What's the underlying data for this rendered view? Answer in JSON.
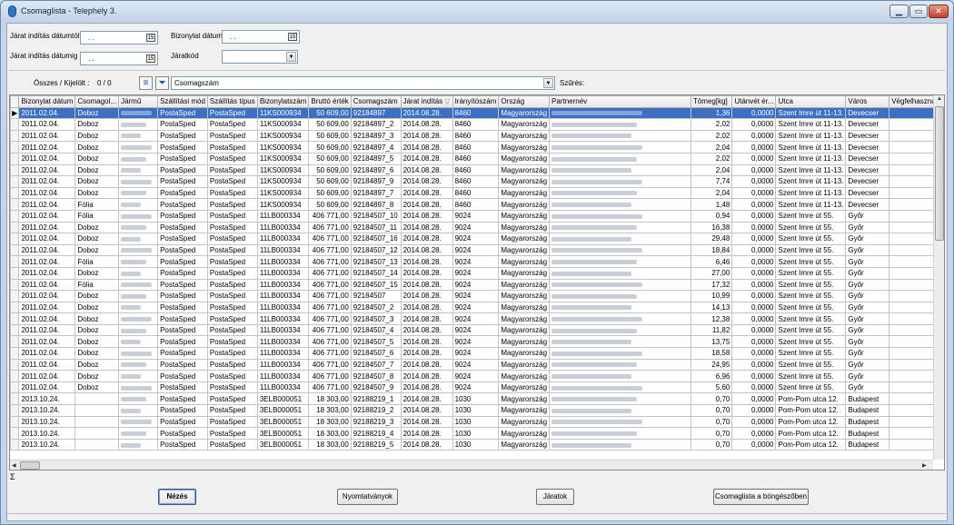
{
  "window": {
    "title": "Csomaglista  -  Telephely 3.",
    "min": "▁",
    "max": "▭",
    "close": "✕"
  },
  "filters": {
    "date_from_label": "Járat indítás dátumtól",
    "date_to_label": "Járat indítás dátumig",
    "doc_date_label": "Bizonylat dátum",
    "route_code_label": "Járatkód",
    "date_from_value": ". .",
    "date_to_value": ". .",
    "doc_date_value": ". .",
    "route_code_value": "",
    "calendar_icon": "calendar-icon"
  },
  "toolbar": {
    "counter_label": "Összes / Kijelölt :",
    "counter_value": "0 / 0",
    "column_selector_value": "Csomagszám",
    "filter_label": "Szűrés:"
  },
  "grid": {
    "columns": [
      "Bizonylat dátum",
      "Csomagol...",
      "Jármű",
      "Szállítási mód",
      "Szállítás típus",
      "Bizonylatszám",
      "Bruttó érték",
      "Csomagszám",
      "Járat indítás",
      "Irányítószám",
      "Ország",
      "Partnernév",
      "Tömeg[kg]",
      "Utánvét ér...",
      "Utca",
      "Város",
      "Végfelhasználó"
    ],
    "sort_column": "Járat indítás",
    "rows": [
      [
        "2011.02.04.",
        "Doboz",
        "",
        "PostaSped",
        "PostaSped",
        "11KS000934",
        "50 609,00",
        "92184897",
        "2014.08.28.",
        "8460",
        "Magyarország",
        "",
        "1,36",
        "0,0000",
        "Szent Imre út 11-13.",
        "Devecser",
        ""
      ],
      [
        "2011.02.04.",
        "Doboz",
        "",
        "PostaSped",
        "PostaSped",
        "11KS000934",
        "50 609,00",
        "92184897_2",
        "2014.08.28.",
        "8460",
        "Magyarország",
        "",
        "2,02",
        "0,0000",
        "Szent Imre út 11-13.",
        "Devecser",
        ""
      ],
      [
        "2011.02.04.",
        "Doboz",
        "",
        "PostaSped",
        "PostaSped",
        "11KS000934",
        "50 609,00",
        "92184897_3",
        "2014.08.28.",
        "8460",
        "Magyarország",
        "",
        "2,02",
        "0,0000",
        "Szent Imre út 11-13.",
        "Devecser",
        ""
      ],
      [
        "2011.02.04.",
        "Doboz",
        "",
        "PostaSped",
        "PostaSped",
        "11KS000934",
        "50 609,00",
        "92184897_4",
        "2014.08.28.",
        "8460",
        "Magyarország",
        "",
        "2,04",
        "0,0000",
        "Szent Imre út 11-13.",
        "Devecser",
        ""
      ],
      [
        "2011.02.04.",
        "Doboz",
        "",
        "PostaSped",
        "PostaSped",
        "11KS000934",
        "50 609,00",
        "92184897_5",
        "2014.08.28.",
        "8460",
        "Magyarország",
        "",
        "2,02",
        "0,0000",
        "Szent Imre út 11-13.",
        "Devecser",
        ""
      ],
      [
        "2011.02.04.",
        "Doboz",
        "",
        "PostaSped",
        "PostaSped",
        "11KS000934",
        "50 609,00",
        "92184897_6",
        "2014.08.28.",
        "8460",
        "Magyarország",
        "",
        "2,04",
        "0,0000",
        "Szent Imre út 11-13.",
        "Devecser",
        ""
      ],
      [
        "2011.02.04.",
        "Doboz",
        "",
        "PostaSped",
        "PostaSped",
        "11KS000934",
        "50 609,00",
        "92184897_9",
        "2014.08.28.",
        "8460",
        "Magyarország",
        "",
        "7,74",
        "0,0000",
        "Szent Imre út 11-13.",
        "Devecser",
        ""
      ],
      [
        "2011.02.04.",
        "Doboz",
        "",
        "PostaSped",
        "PostaSped",
        "11KS000934",
        "50 609,00",
        "92184897_7",
        "2014.08.28.",
        "8460",
        "Magyarország",
        "",
        "2,04",
        "0,0000",
        "Szent Imre út 11-13.",
        "Devecser",
        ""
      ],
      [
        "2011.02.04.",
        "Fólia",
        "",
        "PostaSped",
        "PostaSped",
        "11KS000934",
        "50 609,00",
        "92184897_8",
        "2014.08.28.",
        "8460",
        "Magyarország",
        "",
        "1,48",
        "0,0000",
        "Szent Imre út 11-13.",
        "Devecser",
        ""
      ],
      [
        "2011.02.04.",
        "Fólia",
        "",
        "PostaSped",
        "PostaSped",
        "11LB000334",
        "406 771,00",
        "92184507_10",
        "2014.08.28.",
        "9024",
        "Magyarország",
        "",
        "0,94",
        "0,0000",
        "Szent Imre út 55.",
        "Győr",
        ""
      ],
      [
        "2011.02.04.",
        "Doboz",
        "",
        "PostaSped",
        "PostaSped",
        "11LB000334",
        "406 771,00",
        "92184507_11",
        "2014.08.28.",
        "9024",
        "Magyarország",
        "",
        "16,38",
        "0,0000",
        "Szent Imre út 55.",
        "Győr",
        ""
      ],
      [
        "2011.02.04.",
        "Doboz",
        "",
        "PostaSped",
        "PostaSped",
        "11LB000334",
        "406 771,00",
        "92184507_16",
        "2014.08.28.",
        "9024",
        "Magyarország",
        "",
        "29,48",
        "0,0000",
        "Szent Imre út 55.",
        "Győr",
        ""
      ],
      [
        "2011.02.04.",
        "Doboz",
        "",
        "PostaSped",
        "PostaSped",
        "11LB000334",
        "406 771,00",
        "92184507_12",
        "2014.08.28.",
        "9024",
        "Magyarország",
        "",
        "18,84",
        "0,0000",
        "Szent Imre út 55.",
        "Győr",
        ""
      ],
      [
        "2011.02.04.",
        "Fólia",
        "",
        "PostaSped",
        "PostaSped",
        "11LB000334",
        "406 771,00",
        "92184507_13",
        "2014.08.28.",
        "9024",
        "Magyarország",
        "",
        "6,46",
        "0,0000",
        "Szent Imre út 55.",
        "Győr",
        ""
      ],
      [
        "2011.02.04.",
        "Doboz",
        "",
        "PostaSped",
        "PostaSped",
        "11LB000334",
        "406 771,00",
        "92184507_14",
        "2014.08.28.",
        "9024",
        "Magyarország",
        "",
        "27,00",
        "0,0000",
        "Szent Imre út 55.",
        "Győr",
        ""
      ],
      [
        "2011.02.04.",
        "Fólia",
        "",
        "PostaSped",
        "PostaSped",
        "11LB000334",
        "406 771,00",
        "92184507_15",
        "2014.08.28.",
        "9024",
        "Magyarország",
        "",
        "17,32",
        "0,0000",
        "Szent Imre út 55.",
        "Győr",
        ""
      ],
      [
        "2011.02.04.",
        "Doboz",
        "",
        "PostaSped",
        "PostaSped",
        "11LB000334",
        "406 771,00",
        "92184507",
        "2014.08.28.",
        "9024",
        "Magyarország",
        "",
        "10,99",
        "0,0000",
        "Szent Imre út 55.",
        "Győr",
        ""
      ],
      [
        "2011.02.04.",
        "Doboz",
        "",
        "PostaSped",
        "PostaSped",
        "11LB000334",
        "406 771,00",
        "92184507_2",
        "2014.08.28.",
        "9024",
        "Magyarország",
        "",
        "14,13",
        "0,0000",
        "Szent Imre út 55.",
        "Győr",
        ""
      ],
      [
        "2011.02.04.",
        "Doboz",
        "",
        "PostaSped",
        "PostaSped",
        "11LB000334",
        "406 771,00",
        "92184507_3",
        "2014.08.28.",
        "9024",
        "Magyarország",
        "",
        "12,38",
        "0,0000",
        "Szent Imre út 55.",
        "Győr",
        ""
      ],
      [
        "2011.02.04.",
        "Doboz",
        "",
        "PostaSped",
        "PostaSped",
        "11LB000334",
        "406 771,00",
        "92184507_4",
        "2014.08.28.",
        "9024",
        "Magyarország",
        "",
        "11,82",
        "0,0000",
        "Szent Imre út 55.",
        "Győr",
        ""
      ],
      [
        "2011.02.04.",
        "Doboz",
        "",
        "PostaSped",
        "PostaSped",
        "11LB000334",
        "406 771,00",
        "92184507_5",
        "2014.08.28.",
        "9024",
        "Magyarország",
        "",
        "13,75",
        "0,0000",
        "Szent Imre út 55.",
        "Győr",
        ""
      ],
      [
        "2011.02.04.",
        "Doboz",
        "",
        "PostaSped",
        "PostaSped",
        "11LB000334",
        "406 771,00",
        "92184507_6",
        "2014.08.28.",
        "9024",
        "Magyarország",
        "",
        "18,58",
        "0,0000",
        "Szent Imre út 55.",
        "Győr",
        ""
      ],
      [
        "2011.02.04.",
        "Doboz",
        "",
        "PostaSped",
        "PostaSped",
        "11LB000334",
        "406 771,00",
        "92184507_7",
        "2014.08.28.",
        "9024",
        "Magyarország",
        "",
        "24,95",
        "0,0000",
        "Szent Imre út 55.",
        "Győr",
        ""
      ],
      [
        "2011.02.04.",
        "Doboz",
        "",
        "PostaSped",
        "PostaSped",
        "11LB000334",
        "406 771,00",
        "92184507_8",
        "2014.08.28.",
        "9024",
        "Magyarország",
        "",
        "6,96",
        "0,0000",
        "Szent Imre út 55.",
        "Győr",
        ""
      ],
      [
        "2011.02.04.",
        "Doboz",
        "",
        "PostaSped",
        "PostaSped",
        "11LB000334",
        "406 771,00",
        "92184507_9",
        "2014.08.28.",
        "9024",
        "Magyarország",
        "",
        "5,60",
        "0,0000",
        "Szent Imre út 55.",
        "Győr",
        ""
      ],
      [
        "2013.10.24.",
        "",
        "",
        "PostaSped",
        "PostaSped",
        "3ELB000051",
        "18 303,00",
        "92188219_1",
        "2014.08.28.",
        "1030",
        "Magyarország",
        "",
        "0,70",
        "0,0000",
        "Pom-Pom utca 12.",
        "Budapest",
        ""
      ],
      [
        "2013.10.24.",
        "",
        "",
        "PostaSped",
        "PostaSped",
        "3ELB000051",
        "18 303,00",
        "92188219_2",
        "2014.08.28.",
        "1030",
        "Magyarország",
        "",
        "0,70",
        "0,0000",
        "Pom-Pom utca 12.",
        "Budapest",
        ""
      ],
      [
        "2013.10.24.",
        "",
        "",
        "PostaSped",
        "PostaSped",
        "3ELB000051",
        "18 303,00",
        "92188219_3",
        "2014.08.28.",
        "1030",
        "Magyarország",
        "",
        "0,70",
        "0,0000",
        "Pom-Pom utca 12.",
        "Budapest",
        ""
      ],
      [
        "2013.10.24.",
        "",
        "",
        "PostaSped",
        "PostaSped",
        "3ELB000051",
        "18 303,00",
        "92188219_4",
        "2014.08.28.",
        "1030",
        "Magyarország",
        "",
        "0,70",
        "0,0000",
        "Pom-Pom utca 12.",
        "Budapest",
        ""
      ],
      [
        "2013.10.24.",
        "",
        "",
        "PostaSped",
        "PostaSped",
        "3ELB000051",
        "18 303,00",
        "92188219_5",
        "2014.08.28.",
        "1030",
        "Magyarország",
        "",
        "0,70",
        "0,0000",
        "Pom-Pom utca 12.",
        "Budapest",
        ""
      ]
    ]
  },
  "summary": {
    "sigma": "Σ"
  },
  "footer": {
    "view_label": "Nézés",
    "print_label": "Nyomtatványok",
    "routes_label": "Járatok",
    "browser_label": "Csomaglista a böngészőben"
  },
  "colors": {
    "selection": "#3a6fc2",
    "title_bar": "#c2d3e8"
  }
}
